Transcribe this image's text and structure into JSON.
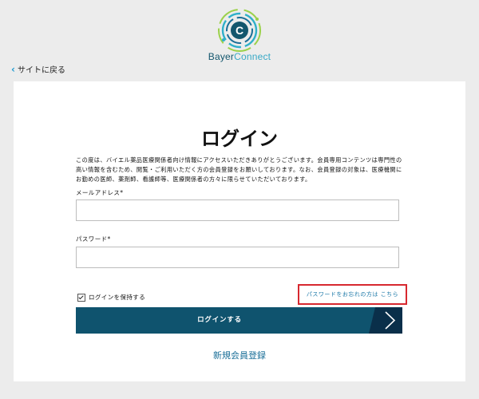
{
  "brand": {
    "part1": "Bayer",
    "part2": "Connect",
    "logo_letter": "C"
  },
  "nav": {
    "back_label": "サイトに戻る"
  },
  "form": {
    "title": "ログイン",
    "intro": "この度は、バイエル薬品医療関係者向け情報にアクセスいただきありがとうございます。会員専用コンテンツは専門性の高い情報を含むため、閲覧・ご利用いただく方の会員登録をお願いしております。なお、会員登録の対象は、医療機関にお勤めの医師、薬剤師、看護師等、医療関係者の方々に限らせていただいております。",
    "email_label": "メールアドレス*",
    "email_value": "",
    "password_label": "パスワード*",
    "password_value": "",
    "remember_label": "ログインを保持する",
    "remember_checked": true,
    "forgot_link": "パスワードをお忘れの方は こちら",
    "login_button": "ログインする",
    "register_link": "新規会員登録"
  },
  "colors": {
    "accent": "#0f536e",
    "button_arrow_panel": "#0a2f4a",
    "link": "#1a6f98",
    "highlight_border": "#d7282f",
    "background": "#ececec"
  },
  "icons": [
    "bayer-connect-logo-icon",
    "chevron-left-icon",
    "checkbox-icon",
    "chevron-right-icon"
  ]
}
